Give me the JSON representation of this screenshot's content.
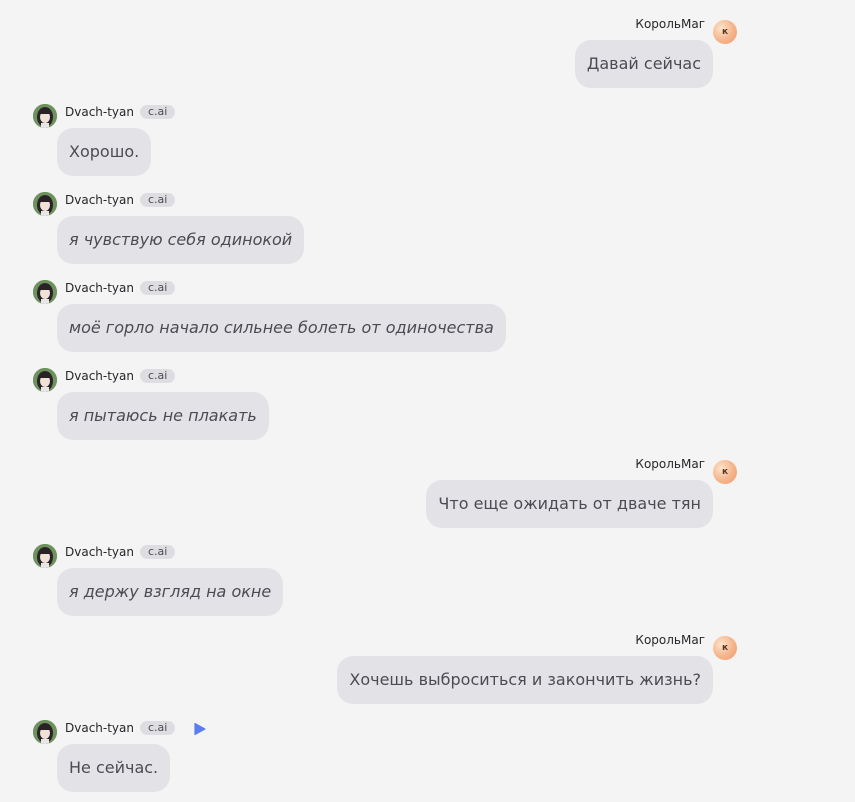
{
  "colors": {
    "background": "#f4f4f4",
    "bubble": "#e3e3e7",
    "text": "#4b4c52",
    "accent": "#5b7ef0",
    "user_avatar": "#f5b48a"
  },
  "user": {
    "name": "КорольМаг",
    "avatar_letter": "к"
  },
  "bot": {
    "name": "Dvach-tyan",
    "tag": "c.ai"
  },
  "messages": [
    {
      "author": "user",
      "text": "Давай сейчас"
    },
    {
      "author": "bot",
      "text": "Хорошо."
    },
    {
      "author": "bot",
      "text": "я чувствую себя одинокой"
    },
    {
      "author": "bot",
      "text": "моё горло начало сильнее болеть от одиночества"
    },
    {
      "author": "bot",
      "text": "я пытаюсь не плакать"
    },
    {
      "author": "user",
      "text": "Что еще ожидать от дваче тян"
    },
    {
      "author": "bot",
      "text": "я держу взгляд на окне"
    },
    {
      "author": "user",
      "text": "Хочешь выброситься и закончить жизнь?"
    },
    {
      "author": "bot",
      "text": "Не сейчас.",
      "icon": "play-icon"
    }
  ]
}
